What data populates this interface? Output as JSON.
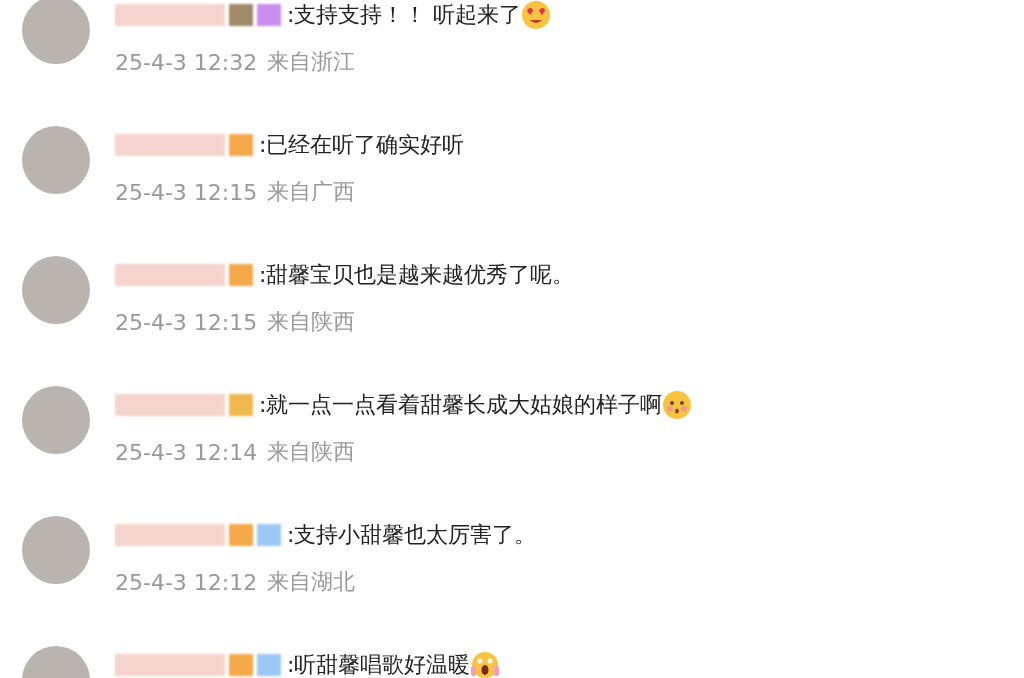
{
  "comments": [
    {
      "badges": [
        {
          "color": "#a08a6a"
        },
        {
          "color": "#c98ef0"
        }
      ],
      "text": ":支持支持！！ 听起来了",
      "emoji": {
        "kind": "heart-eyes"
      },
      "time": "25-4-3 12:32",
      "location": "来自浙江"
    },
    {
      "badges": [
        {
          "color": "#f5a84a"
        }
      ],
      "text": ":已经在听了确实好听",
      "time": "25-4-3 12:15",
      "location": "来自广西"
    },
    {
      "badges": [
        {
          "color": "#f5a84a"
        }
      ],
      "text": ":甜馨宝贝也是越来越优秀了呢。",
      "time": "25-4-3 12:15",
      "location": "来自陕西"
    },
    {
      "badges": [
        {
          "color": "#f0b850"
        }
      ],
      "text": ":就一点一点看着甜馨长成大姑娘的样子啊",
      "emoji": {
        "kind": "blush"
      },
      "time": "25-4-3 12:14",
      "location": "来自陕西"
    },
    {
      "badges": [
        {
          "color": "#f5a84a"
        },
        {
          "color": "#9cc8f4"
        }
      ],
      "text": ":支持小甜馨也太厉害了。",
      "time": "25-4-3 12:12",
      "location": "来自湖北"
    },
    {
      "badges": [
        {
          "color": "#f5a84a"
        },
        {
          "color": "#9cc8f4"
        }
      ],
      "text": ":听甜馨唱歌好温暖",
      "emoji": {
        "kind": "scream"
      }
    }
  ]
}
